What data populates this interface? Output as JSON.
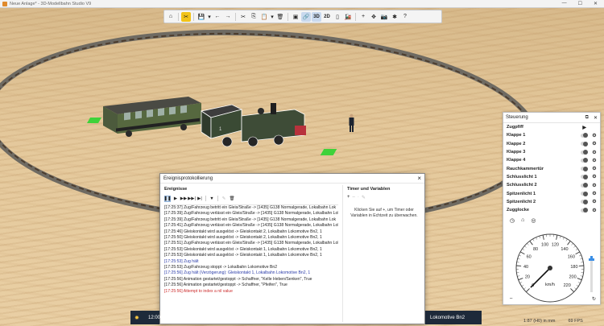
{
  "window": {
    "title": "Neue Anlage* - 3D-Modellbahn Studio V9",
    "minimize": "—",
    "maximize": "☐",
    "close": "✕"
  },
  "toolbar": {
    "home_icon": "⌂",
    "tools_icon": "✂",
    "save_icon": "💾",
    "dropdown_icon": "▾",
    "undo_icon": "←",
    "redo_icon": "→",
    "cut_icon": "✂",
    "copy_icon": "⎘",
    "paste_icon": "📋",
    "delete_icon": "🗑",
    "select_icon": "▣",
    "link_icon": "🔗",
    "view3d": "3D",
    "view2d": "2D",
    "camera_icon": "▯",
    "train_icon": "🚂",
    "add_icon": "+",
    "move_icon": "✥",
    "screenshot_icon": "📷",
    "plugin_icon": "✱",
    "help_icon": "?"
  },
  "steuerung": {
    "title": "Steuerung",
    "popout_icon": "⧉",
    "close_icon": "✕",
    "items": [
      {
        "label": "Zugpfiff",
        "type": "play"
      },
      {
        "label": "Klappe 1",
        "type": "toggle"
      },
      {
        "label": "Klappe 2",
        "type": "toggle"
      },
      {
        "label": "Klappe 3",
        "type": "toggle"
      },
      {
        "label": "Klappe 4",
        "type": "toggle"
      },
      {
        "label": "Rauchkammertür",
        "type": "toggle"
      },
      {
        "label": "Schlusslicht 1",
        "type": "toggle"
      },
      {
        "label": "Schlusslicht 2",
        "type": "toggle"
      },
      {
        "label": "Spitzenlicht 1",
        "type": "toggle"
      },
      {
        "label": "Spitzenlicht 2",
        "type": "toggle"
      },
      {
        "label": "Zugglocke",
        "type": "toggle"
      }
    ],
    "gauge": {
      "unit": "km/h",
      "ticks": [
        "0",
        "20",
        "40",
        "60",
        "80",
        "100",
        "120",
        "140",
        "160",
        "180",
        "200",
        "220"
      ],
      "max": 220,
      "speed": 0
    },
    "speed_level": 0.12,
    "bottom_left": "–",
    "bottom_right": "↻"
  },
  "dialog": {
    "title": "Ereignisprotokollierung",
    "events_title": "Ereignisse",
    "timers_title": "Timer und Variablen",
    "timers_help": "Klicken Sie auf +, um Timer oder Variablen in Echtzeit zu überwachen.",
    "log": [
      {
        "text": "[17:25:37] Zug/Fahrzeug betritt ein Gleis/Straße -> [1435] G138 Normalgerade, Lokalbahn Lok",
        "color": "black"
      },
      {
        "text": "[17:25:39] Zug/Fahrzeug verlässt ein Gleis/Straße -> [1435] G138 Normalgerade, Lokalbahn Lok",
        "color": "black"
      },
      {
        "text": "[17:25:39] Zug/Fahrzeug betritt ein Gleis/Straße -> [1435] G138 Normalgerade, Lokalbahn Lok",
        "color": "black"
      },
      {
        "text": "[17:25:41] Zug/Fahrzeug verlässt ein Gleis/Straße -> [1435] G138 Normalgerade, Lokalbahn Lok",
        "color": "black"
      },
      {
        "text": "[17:25:46] Gleiskontakt wird ausgelöst -> Gleiskontakt 2, Lokalbahn Lokomotive Bn2, 1",
        "color": "black"
      },
      {
        "text": "[17:25:50] Gleiskontakt wird ausgelöst -> Gleiskontakt 2, Lokalbahn Lokomotive Bn2, 1",
        "color": "black"
      },
      {
        "text": "[17:25:51] Zug/Fahrzeug verlässt ein Gleis/Straße -> [1435] G138 Normalgerade, Lokalbahn Lok",
        "color": "black"
      },
      {
        "text": "[17:25:53] Gleiskontakt wird ausgelöst -> Gleiskontakt 1, Lokalbahn Lokomotive Bn2, 1",
        "color": "black"
      },
      {
        "text": "[17:25:53] Gleiskontakt wird ausgelöst -> Gleiskontakt 1, Lokalbahn Lokomotive Bn2, 1",
        "color": "black"
      },
      {
        "text": "[17:25:53]      Zug hält",
        "color": "blue"
      },
      {
        "text": "[17:25:53] Zug/Fahrzeug stoppt -> Lokalbahn Lokomotive Bn2",
        "color": "black"
      },
      {
        "text": "[17:25:56] Zug hält (Verzögerung): Gleiskontakt 1, Lokalbahn Lokomotive Bn2, 1",
        "color": "blue"
      },
      {
        "text": "[17:25:56]      Animation gestartet/gestoppt -> Schaffner, \"Kelle Heben/Senken\", True",
        "color": "black"
      },
      {
        "text": "[17:25:56]      Animation gestartet/gestoppt -> Schaffner, \"Pfeifen\", True",
        "color": "black"
      },
      {
        "text": "[17:25:56]      Attempt to index a nil value",
        "color": "red"
      }
    ]
  },
  "bottom": {
    "time": "12:00",
    "loco_name": "Lokomotive Bn2",
    "scale": "1:87 (H0) in mm",
    "fps": "69 FPS"
  },
  "colors": {
    "accent_yellow": "#f2c318",
    "select_blue": "#c9d9ee",
    "log_blue": "#2a3ba8",
    "log_red": "#cc2b2b"
  }
}
